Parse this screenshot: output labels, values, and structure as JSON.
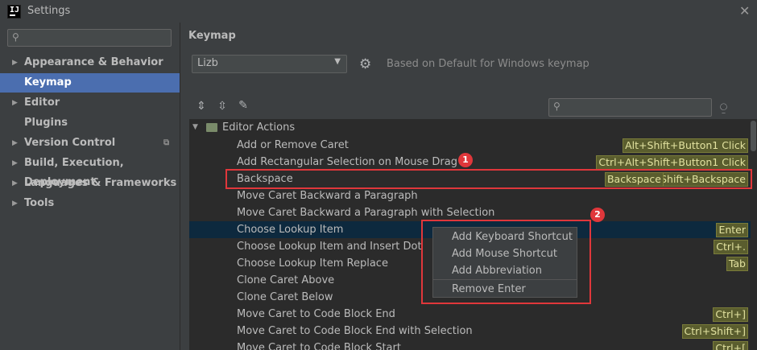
{
  "window": {
    "title": "Settings",
    "logo_text": "IJ"
  },
  "left": {
    "search_placeholder": "",
    "items": [
      {
        "label": "Appearance & Behavior",
        "expandable": true
      },
      {
        "label": "Keymap",
        "expandable": false,
        "selected": true
      },
      {
        "label": "Editor",
        "expandable": true
      },
      {
        "label": "Plugins",
        "expandable": false
      },
      {
        "label": "Version Control",
        "expandable": true
      },
      {
        "label": "Build, Execution, Deployment",
        "expandable": true
      },
      {
        "label": "Languages & Frameworks",
        "expandable": true
      },
      {
        "label": "Tools",
        "expandable": true
      }
    ]
  },
  "right": {
    "title": "Keymap",
    "keymap_value": "Lizb",
    "based_on": "Based on Default for Windows keymap",
    "search_placeholder": ""
  },
  "tree": {
    "group": "Editor Actions",
    "rows": [
      {
        "label": "Add or Remove Caret",
        "shortcuts": [
          "Alt+Shift+Button1 Click"
        ]
      },
      {
        "label": "Add Rectangular Selection on Mouse Drag",
        "shortcuts": [
          "Ctrl+Alt+Shift+Button1 Click"
        ]
      },
      {
        "label": "Backspace",
        "shortcuts": [
          "Backspace",
          "Shift+Backspace"
        ]
      },
      {
        "label": "Move Caret Backward a Paragraph",
        "shortcuts": []
      },
      {
        "label": "Move Caret Backward a Paragraph with Selection",
        "shortcuts": []
      },
      {
        "label": "Choose Lookup Item",
        "shortcuts": [
          "Enter"
        ],
        "selected": true
      },
      {
        "label": "Choose Lookup Item and Insert Dot",
        "shortcuts": [
          "Ctrl+."
        ]
      },
      {
        "label": "Choose Lookup Item Replace",
        "shortcuts": [
          "Tab"
        ]
      },
      {
        "label": "Clone Caret Above",
        "shortcuts": []
      },
      {
        "label": "Clone Caret Below",
        "shortcuts": []
      },
      {
        "label": "Move Caret to Code Block End",
        "shortcuts": [
          "Ctrl+]"
        ]
      },
      {
        "label": "Move Caret to Code Block End with Selection",
        "shortcuts": [
          "Ctrl+Shift+]"
        ]
      },
      {
        "label": "Move Caret to Code Block Start",
        "shortcuts": [
          "Ctrl+["
        ]
      }
    ]
  },
  "context_menu": {
    "items": [
      "Add Keyboard Shortcut",
      "Add Mouse Shortcut",
      "Add Abbreviation",
      "Remove Enter"
    ]
  },
  "annotations": {
    "marker1": "1",
    "marker2": "2"
  },
  "colors": {
    "background": "#3c3f41",
    "tree_background": "#2b2b2b",
    "selection": "#4b6eaf",
    "row_selection": "#0d293e",
    "shortcut_badge": "#5a5d2e",
    "annotation_red": "#e0373b"
  },
  "icons": [
    "close-icon",
    "search-icon",
    "gear-icon",
    "expand-all-icon",
    "collapse-all-icon",
    "edit-icon",
    "find-by-shortcut-icon",
    "folder-icon"
  ]
}
